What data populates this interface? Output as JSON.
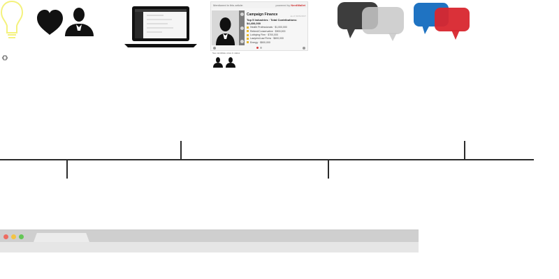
{
  "icons": {
    "bulb": "lightbulb-icon",
    "arrows": [
      "chevron-left-icon",
      "chevron-right-icon"
    ],
    "heart": "heart-icon",
    "person": "person-icon",
    "laptop": "laptop-icon",
    "bubbles_gray": "speech-bubbles-gray-icon",
    "bubbles_color": "speech-bubbles-color-icon"
  },
  "nav": {
    "prev": "‹",
    "next": "›"
  },
  "card": {
    "header_title": "Mentioned in this article:",
    "powered_by": "powered by",
    "powered_brand": "NerdWallet",
    "title": "Campaign Finance",
    "subtitle": "Top 5 Industries · Total Contributions: $4,400,000",
    "meta": "as of 01/01/2017",
    "rows": [
      "Health Professionals · $1,000,000",
      "Retired/Conservative · $900,000",
      "Lobbying Firm · $700,000",
      "Lawyers/Law Firms · $600,000",
      "Energy · $500,000"
    ],
    "below": "See candidate votes in states"
  },
  "colors": {
    "bulb": "#f4f27d",
    "gray_dark": "#3d3d3d",
    "gray_light": "#c8c8c8",
    "blue": "#1f73c2",
    "red": "#d8262e",
    "timeline": "#2b2b2b",
    "browser_top": "#cfcfcf",
    "browser_bottom": "#e6e6e6"
  }
}
